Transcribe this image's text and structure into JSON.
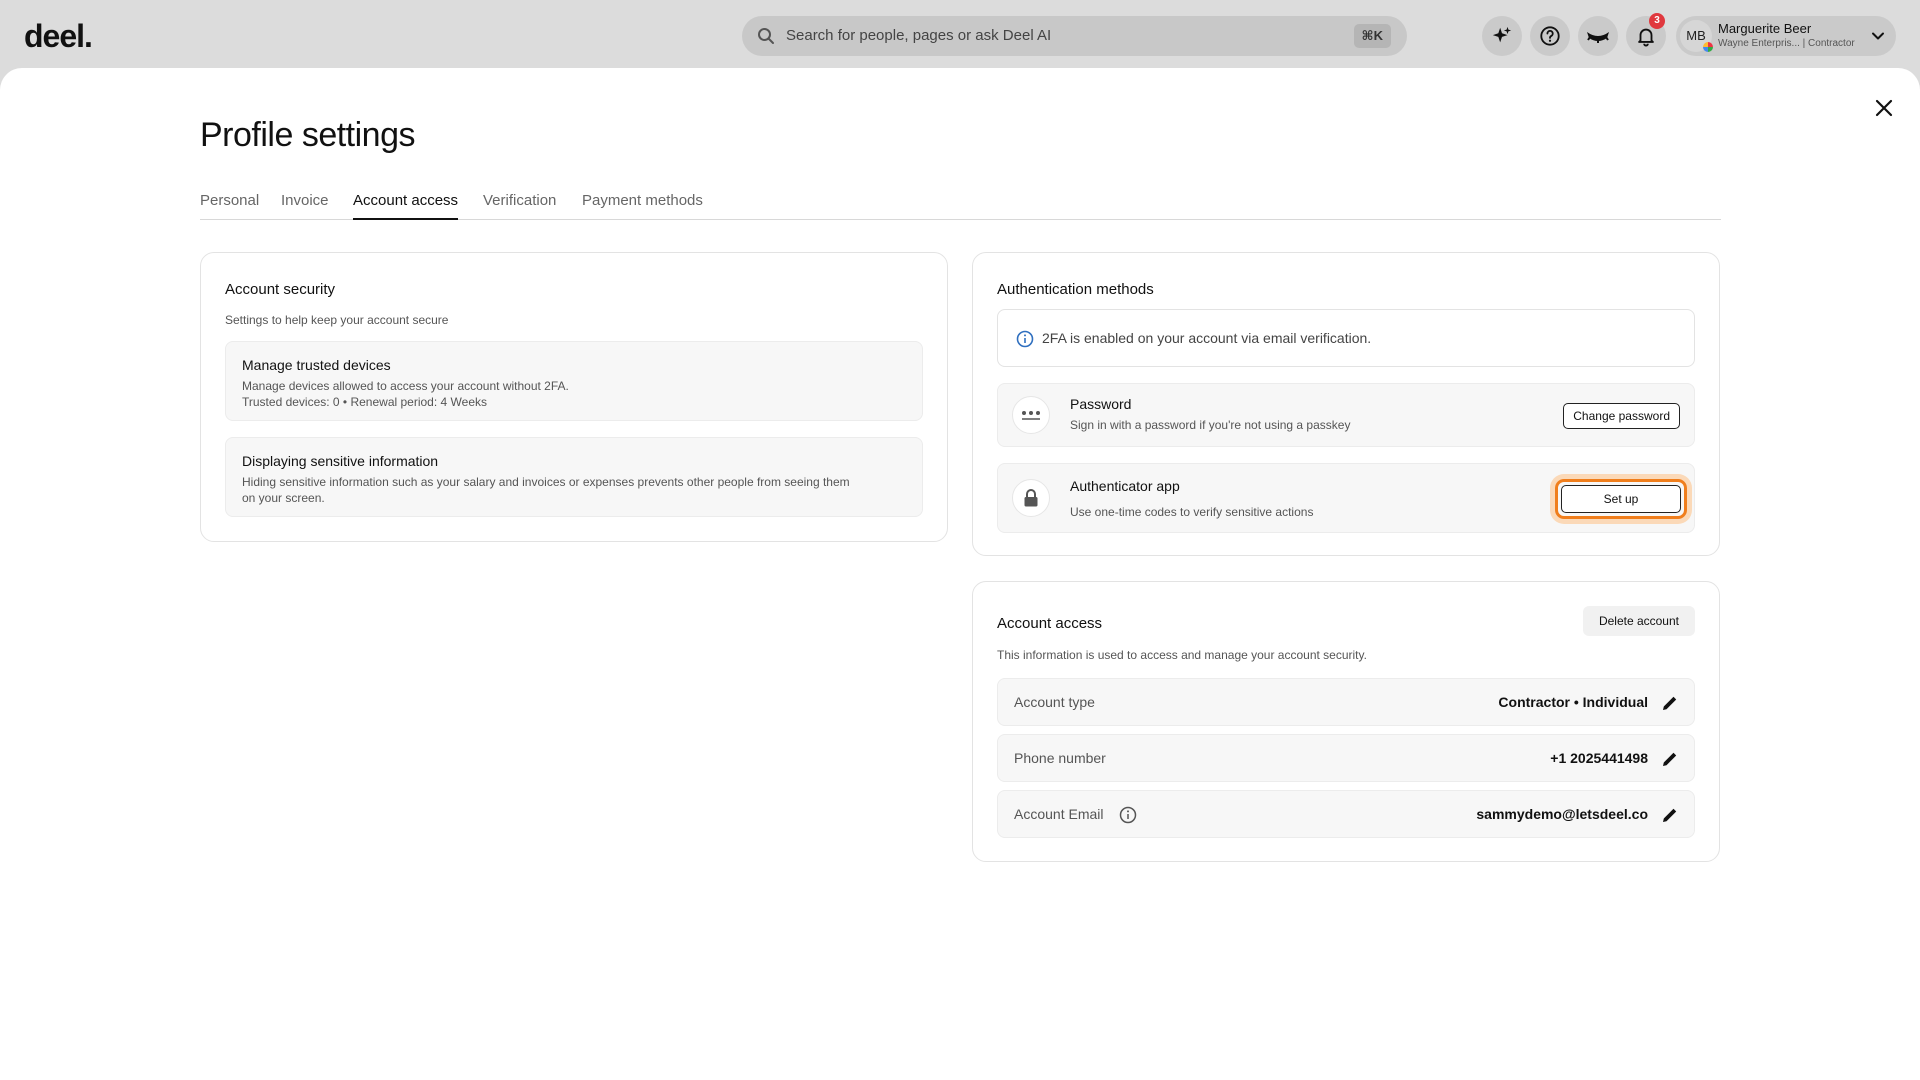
{
  "header": {
    "logo": "deel.",
    "search_placeholder": "Search for people, pages or ask Deel AI",
    "search_shortcut": "⌘K",
    "notification_count": "3",
    "user": {
      "initials": "MB",
      "name": "Marguerite Beer",
      "subtitle": "Wayne Enterpris... | Contractor"
    }
  },
  "page": {
    "title": "Profile settings",
    "tabs": [
      {
        "label": "Personal"
      },
      {
        "label": "Invoice"
      },
      {
        "label": "Account access",
        "active": true
      },
      {
        "label": "Verification"
      },
      {
        "label": "Payment methods"
      }
    ]
  },
  "account_security": {
    "title": "Account security",
    "subtitle": "Settings to help keep your account secure",
    "items": [
      {
        "title": "Manage trusted devices",
        "description": "Manage devices allowed to access your account without 2FA.",
        "meta": "Trusted devices: 0 • Renewal period: 4 Weeks"
      },
      {
        "title": "Displaying sensitive information",
        "description": "Hiding sensitive information such as your salary and invoices or expenses prevents other people from seeing them",
        "description2": "on your screen."
      }
    ]
  },
  "auth_methods": {
    "title": "Authentication methods",
    "info": "2FA is enabled on your account via email verification.",
    "password": {
      "title": "Password",
      "description": "Sign in with a password if you're not using a passkey",
      "button": "Change password"
    },
    "authenticator": {
      "title": "Authenticator app",
      "description": "Use one-time codes to verify sensitive actions",
      "button": "Set up"
    }
  },
  "account_access": {
    "title": "Account access",
    "subtitle": "This information is used to access and manage your account security.",
    "delete_button": "Delete account",
    "rows": [
      {
        "label": "Account type",
        "value": "Contractor • Individual"
      },
      {
        "label": "Phone number",
        "value": "+1 2025441498"
      },
      {
        "label": "Account Email",
        "value": "sammydemo@letsdeel.co"
      }
    ]
  },
  "colors": {
    "focus_ring": "#f07e1c",
    "badge": "#e0383e",
    "info_icon": "#2f6fbf"
  }
}
